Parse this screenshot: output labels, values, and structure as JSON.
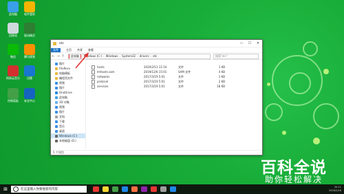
{
  "desktop": {
    "icons": [
      {
        "label": "此电脑",
        "color": "#3aa0e8"
      },
      {
        "label": "软件管家",
        "color": "#f4b400"
      },
      {
        "label": "回收站",
        "color": "#cfd8dc"
      },
      {
        "label": "驱动精灵",
        "color": "#2e7d32"
      },
      {
        "label": "微信",
        "color": "#09bb07"
      },
      {
        "label": "腾讯视频",
        "color": "#ff8f00"
      },
      {
        "label": "网易云音乐",
        "color": "#d32f2f"
      },
      {
        "label": "迅雷",
        "color": "#1976d2"
      },
      {
        "label": "控制面板",
        "color": "#43a047"
      },
      {
        "label": "安全中心",
        "color": "#1565c0"
      }
    ]
  },
  "window": {
    "title": "etc",
    "controls": {
      "min": "—",
      "max": "☐",
      "close": "✕"
    },
    "ribbon": {
      "file": "文件",
      "home": "主页",
      "share": "共享",
      "view": "查看"
    },
    "address": {
      "crumbs": [
        "此电脑",
        "Windows (C:)",
        "Windows",
        "System32",
        "drivers",
        "etc"
      ],
      "search_placeholder": "搜索\"etc\""
    },
    "nav": [
      {
        "label": "图片",
        "color": "#3a8ee6"
      },
      {
        "label": "FileRecv",
        "color": "#e6b940"
      },
      {
        "label": "电脑模板",
        "color": "#e6b940"
      },
      {
        "label": "编程用文件",
        "color": "#e6b940"
      },
      {
        "label": "视频",
        "color": "#3a8ee6"
      },
      {
        "label": "图片",
        "color": "#3a8ee6"
      },
      {
        "label": "OneDrive",
        "color": "#1e88e5"
      },
      {
        "label": "此电脑",
        "color": "#3aa0e8"
      },
      {
        "label": "3D 对象",
        "color": "#6ab0e8"
      },
      {
        "label": "视频",
        "color": "#3a8ee6"
      },
      {
        "label": "图片",
        "color": "#3a8ee6"
      },
      {
        "label": "文档",
        "color": "#9e9e9e"
      },
      {
        "label": "下载",
        "color": "#3a8ee6"
      },
      {
        "label": "音乐",
        "color": "#3a8ee6"
      },
      {
        "label": "桌面",
        "color": "#3a8ee6"
      },
      {
        "label": "Windows (C:)",
        "color": "#666666"
      },
      {
        "label": "本地磁盘 (D:)",
        "color": "#666666"
      }
    ],
    "files": [
      {
        "name": "hosts",
        "date": "2020/2/13 11:54",
        "type": "文件",
        "size": "1 KB"
      },
      {
        "name": "lmhosts.sam",
        "date": "2019/12/6 15:01",
        "type": "SAM 文件",
        "size": "4 KB"
      },
      {
        "name": "networks",
        "date": "2017/3/19 5:01",
        "type": "文件",
        "size": "1 KB"
      },
      {
        "name": "protocol",
        "date": "2017/3/19 5:01",
        "type": "文件",
        "size": "2 KB"
      },
      {
        "name": "services",
        "date": "2017/3/19 5:01",
        "type": "文件",
        "size": "18 KB"
      }
    ],
    "status": "5 个项目"
  },
  "watermark": {
    "big": "百科全说",
    "small": "助你轻松解决"
  },
  "taskbar": {
    "start": "⊞",
    "search_placeholder": "在这里输入你要搜索的内容",
    "apps": [
      "#e53935",
      "#fdd835",
      "#43a047",
      "#1e88e5",
      "#ff7043",
      "#8e24aa",
      "#e53935",
      "#9e9e9e",
      "#1e88e5"
    ],
    "time": "20:11",
    "date": "2020/2/16"
  },
  "colors": {
    "accent": "#1a73c6",
    "highlight": "#e33333"
  }
}
